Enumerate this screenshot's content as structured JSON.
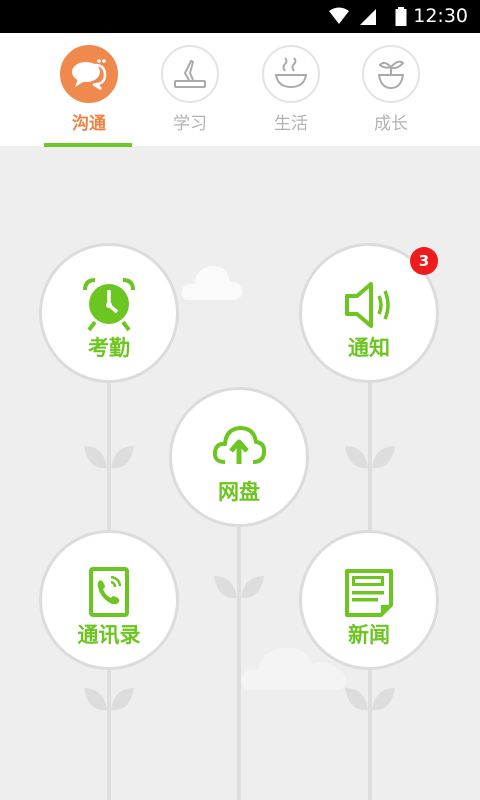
{
  "status_bar": {
    "time": "12:30",
    "icons": [
      "wifi-icon",
      "signal-icon",
      "battery-icon"
    ]
  },
  "tabs": [
    {
      "label": "沟通",
      "icon": "chat-bubbles-icon",
      "active": true
    },
    {
      "label": "学习",
      "icon": "pen-book-icon",
      "active": false
    },
    {
      "label": "生活",
      "icon": "steaming-bowl-icon",
      "active": false
    },
    {
      "label": "成长",
      "icon": "sprout-pot-icon",
      "active": false
    }
  ],
  "features": {
    "attendance": {
      "label": "考勤",
      "icon": "alarm-clock-icon"
    },
    "notice": {
      "label": "通知",
      "icon": "speaker-icon",
      "badge": "3"
    },
    "netdisk": {
      "label": "网盘",
      "icon": "cloud-upload-icon"
    },
    "contacts": {
      "label": "通讯录",
      "icon": "phone-book-icon"
    },
    "news": {
      "label": "新闻",
      "icon": "newspaper-icon"
    }
  },
  "colors": {
    "accent_green": "#6cc520",
    "tab_orange": "#f0894e",
    "badge_red": "#ee1c1c",
    "underline_green": "#6cc825"
  }
}
